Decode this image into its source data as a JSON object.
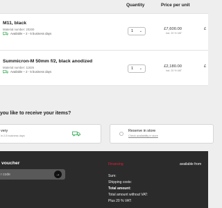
{
  "columns": {
    "quantity": "Quantity",
    "price_per_unit": "Price per unit"
  },
  "items": [
    {
      "name": "M11, black",
      "material": "Material number: 20200",
      "availability": "Available – 2 - 5 business days",
      "quantity": "1",
      "price": "£7,600.00",
      "vat": "incl. 20 % VAT",
      "total_partial": "£"
    },
    {
      "name": "Summicron-M 50mm f/2, black anodized",
      "material": "Material number: 11826",
      "availability": "Available – 2 - 5 business days",
      "quantity": "1",
      "price": "£2,180.00",
      "vat": "incl. 20 % VAT",
      "total_partial": "£"
    }
  ],
  "delivery": {
    "title_partial": "you like to receive your items?",
    "option1_title_partial": "very",
    "option1_sub_partial": "in 2-5 business days",
    "option2_title": "Reserve in store",
    "option2_link": "Check availability in store"
  },
  "footer": {
    "voucher_title_partial": "voucher",
    "voucher_placeholder_partial": "r code",
    "voucher_button": "→",
    "financing": "Financing",
    "available_from_partial": "available from",
    "summary": [
      {
        "label": "Sum:",
        "bold": false
      },
      {
        "label": "Shipping costs:",
        "bold": false
      },
      {
        "label": "Total amount:",
        "bold": true
      },
      {
        "label": "Total amount without VAT:",
        "bold": false
      },
      {
        "label": "Plus 20 % VAT:",
        "bold": false
      }
    ]
  },
  "colors": {
    "accent_green": "#2fa84f",
    "financing_red": "#e0203a",
    "footer_bg": "#2b2b2b"
  },
  "icons": {
    "availability": "truck-icon",
    "dropdown": "chevron-down-icon",
    "delivery": "truck-icon",
    "submit": "arrow-right-icon"
  }
}
